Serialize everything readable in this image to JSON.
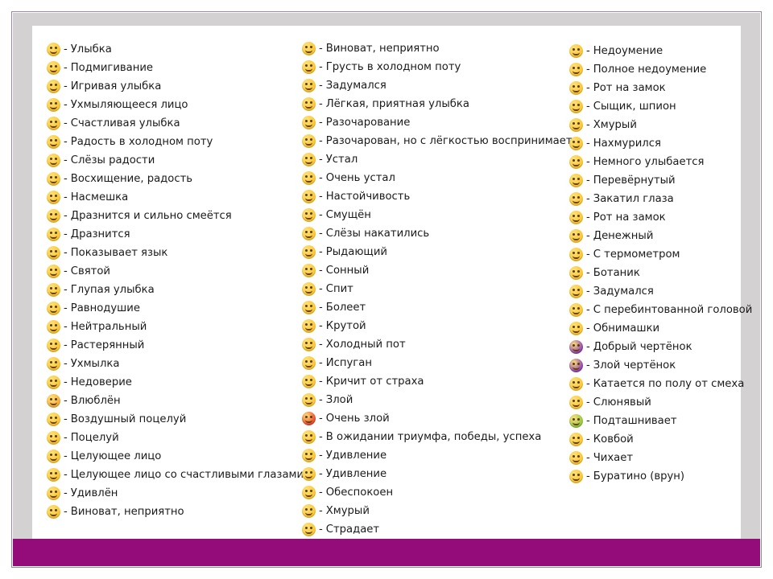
{
  "colors": {
    "frame": "#d3d1d1",
    "bar": "#930c7a",
    "card": "#ffffff",
    "face": "#f7c531"
  },
  "separator": "-",
  "columns": [
    {
      "items": [
        {
          "icon": "smiling-face-icon",
          "color": "#f7c531",
          "label": "Улыбка"
        },
        {
          "icon": "winking-face-icon",
          "color": "#f7c531",
          "label": "Подмигивание"
        },
        {
          "icon": "playful-smile-icon",
          "color": "#f7c531",
          "label": "Игривая улыбка"
        },
        {
          "icon": "grinning-face-icon",
          "color": "#f7c531",
          "label": "Ухмыляющееся лицо"
        },
        {
          "icon": "happy-smile-icon",
          "color": "#f7c531",
          "label": "Счастливая улыбка"
        },
        {
          "icon": "cold-sweat-joy-icon",
          "color": "#f7c531",
          "label": "Радость в холодном поту"
        },
        {
          "icon": "tears-of-joy-icon",
          "color": "#f7c531",
          "label": "Слёзы радости"
        },
        {
          "icon": "delight-icon",
          "color": "#f7c531",
          "label": "Восхищение, радость"
        },
        {
          "icon": "mockery-icon",
          "color": "#f7c531",
          "label": "Насмешка"
        },
        {
          "icon": "laughing-teasing-icon",
          "color": "#f7c531",
          "label": "Дразнится и сильно смеётся"
        },
        {
          "icon": "teasing-icon",
          "color": "#f7c531",
          "label": "Дразнится"
        },
        {
          "icon": "tongue-out-icon",
          "color": "#f7c531",
          "label": "Показывает язык"
        },
        {
          "icon": "halo-icon",
          "color": "#f7c531",
          "label": "Святой"
        },
        {
          "icon": "silly-smile-icon",
          "color": "#f7c531",
          "label": "Глупая улыбка"
        },
        {
          "icon": "indifference-icon",
          "color": "#f7c531",
          "label": "Равнодушие"
        },
        {
          "icon": "neutral-face-icon",
          "color": "#f7c531",
          "label": "Нейтральный"
        },
        {
          "icon": "confused-face-icon",
          "color": "#f7c531",
          "label": "Растерянный"
        },
        {
          "icon": "smirk-icon",
          "color": "#f7c531",
          "label": "Ухмылка"
        },
        {
          "icon": "distrust-icon",
          "color": "#f7c531",
          "label": "Недоверие"
        },
        {
          "icon": "heart-eyes-icon",
          "color": "#f2a93a",
          "label": "Влюблён"
        },
        {
          "icon": "blowing-kiss-icon",
          "color": "#f7c531",
          "label": "Воздушный поцелуй"
        },
        {
          "icon": "kiss-icon",
          "color": "#f7c531",
          "label": "Поцелуй"
        },
        {
          "icon": "kissing-face-icon",
          "color": "#f7c531",
          "label": "Целующее лицо"
        },
        {
          "icon": "kissing-smiling-eyes-icon",
          "color": "#f7c531",
          "label": "Целующее лицо со счастливыми глазами"
        },
        {
          "icon": "astonished-icon",
          "color": "#f7c531",
          "label": "Удивлён"
        },
        {
          "icon": "guilty-icon",
          "color": "#f7c531",
          "label": "Виноват, неприятно"
        }
      ]
    },
    {
      "items": [
        {
          "icon": "guilty-icon",
          "color": "#f7c531",
          "label": "Виноват, неприятно"
        },
        {
          "icon": "cold-sweat-sad-icon",
          "color": "#f7c531",
          "label": "Грусть в холодном поту"
        },
        {
          "icon": "pensive-icon",
          "color": "#f7c531",
          "label": "Задумался"
        },
        {
          "icon": "relieved-smile-icon",
          "color": "#f7c531",
          "label": "Лёгкая, приятная улыбка"
        },
        {
          "icon": "disappointed-icon",
          "color": "#f7c531",
          "label": "Разочарование"
        },
        {
          "icon": "disappointed-relieved-icon",
          "color": "#f7c531",
          "label": "Разочарован, но с лёгкостью воспринимает"
        },
        {
          "icon": "tired-icon",
          "color": "#f7c531",
          "label": "Устал"
        },
        {
          "icon": "very-tired-icon",
          "color": "#f7c531",
          "label": "Очень устал"
        },
        {
          "icon": "persevering-icon",
          "color": "#f7c531",
          "label": "Настойчивость"
        },
        {
          "icon": "embarrassed-icon",
          "color": "#f7c531",
          "label": "Смущён"
        },
        {
          "icon": "teary-icon",
          "color": "#f7c531",
          "label": "Слёзы накатились"
        },
        {
          "icon": "crying-icon",
          "color": "#f7c531",
          "label": "Рыдающий"
        },
        {
          "icon": "sleepy-icon",
          "color": "#f7c531",
          "label": "Сонный"
        },
        {
          "icon": "sleeping-icon",
          "color": "#f7c531",
          "label": "Спит"
        },
        {
          "icon": "sick-mask-icon",
          "color": "#f7c531",
          "label": "Болеет"
        },
        {
          "icon": "sunglasses-icon",
          "color": "#f7c531",
          "label": "Крутой"
        },
        {
          "icon": "cold-sweat-icon",
          "color": "#f7c531",
          "label": "Холодный пот"
        },
        {
          "icon": "fearful-icon",
          "color": "#f7c531",
          "label": "Испуган"
        },
        {
          "icon": "screaming-fear-icon",
          "color": "#f7c531",
          "label": "Кричит от страха"
        },
        {
          "icon": "angry-icon",
          "color": "#f7c531",
          "label": "Злой"
        },
        {
          "icon": "very-angry-icon",
          "color": "#e8452c",
          "label": "Очень злой"
        },
        {
          "icon": "triumph-icon",
          "color": "#f7c531",
          "label": "В ожидании триумфа, победы, успеха"
        },
        {
          "icon": "surprised-icon",
          "color": "#f7c531",
          "label": "Удивление"
        },
        {
          "icon": "surprised-open-mouth-icon",
          "color": "#f7c531",
          "label": "Удивление"
        },
        {
          "icon": "worried-icon",
          "color": "#f7c531",
          "label": "Обеспокоен"
        },
        {
          "icon": "frowning-icon",
          "color": "#f7c531",
          "label": "Хмурый"
        },
        {
          "icon": "anguished-icon",
          "color": "#f7c531",
          "label": "Страдает"
        }
      ]
    },
    {
      "items": [
        {
          "icon": "puzzled-icon",
          "color": "#f7c531",
          "label": "Недоумение"
        },
        {
          "icon": "utter-confusion-icon",
          "color": "#f7c531",
          "label": "Полное недоумение"
        },
        {
          "icon": "zipper-mouth-icon",
          "color": "#f7c531",
          "label": "Рот на замок"
        },
        {
          "icon": "detective-icon",
          "color": "#f7c531",
          "label": "Сыщик, шпион"
        },
        {
          "icon": "frowning-face-icon",
          "color": "#f7c531",
          "label": "Хмурый"
        },
        {
          "icon": "slightly-frowning-icon",
          "color": "#f7c531",
          "label": "Нахмурился"
        },
        {
          "icon": "slightly-smiling-icon",
          "color": "#f7c531",
          "label": "Немного улыбается"
        },
        {
          "icon": "upside-down-icon",
          "color": "#f7c531",
          "label": "Перевёрнутый"
        },
        {
          "icon": "eye-roll-icon",
          "color": "#f7c531",
          "label": "Закатил глаза"
        },
        {
          "icon": "zipper-mouth-icon",
          "color": "#f7c531",
          "label": "Рот на замок"
        },
        {
          "icon": "money-face-icon",
          "color": "#f7c531",
          "label": "Денежный"
        },
        {
          "icon": "thermometer-face-icon",
          "color": "#f7c531",
          "label": "С термометром"
        },
        {
          "icon": "nerd-icon",
          "color": "#f7c531",
          "label": "Ботаник"
        },
        {
          "icon": "thinking-icon",
          "color": "#f7c531",
          "label": "Задумался"
        },
        {
          "icon": "bandaged-head-icon",
          "color": "#f7c531",
          "label": "С перебинтованной головой"
        },
        {
          "icon": "hugging-icon",
          "color": "#f7c531",
          "label": "Обнимашки"
        },
        {
          "icon": "smiling-imp-icon",
          "color": "#8a3fb3",
          "label": "Добрый чертёнок"
        },
        {
          "icon": "angry-imp-icon",
          "color": "#8a3fb3",
          "label": "Злой чертёнок"
        },
        {
          "icon": "rolling-laughing-icon",
          "color": "#f7c531",
          "label": "Катается по полу от смеха"
        },
        {
          "icon": "drooling-icon",
          "color": "#f7c531",
          "label": "Слюнявый"
        },
        {
          "icon": "nauseated-icon",
          "color": "#8cc63f",
          "label": "Подташнивает"
        },
        {
          "icon": "cowboy-icon",
          "color": "#f7c531",
          "label": "Ковбой"
        },
        {
          "icon": "sneezing-icon",
          "color": "#f7c531",
          "label": "Чихает"
        },
        {
          "icon": "lying-face-icon",
          "color": "#f7c531",
          "label": "Буратино (врун)"
        }
      ]
    }
  ]
}
